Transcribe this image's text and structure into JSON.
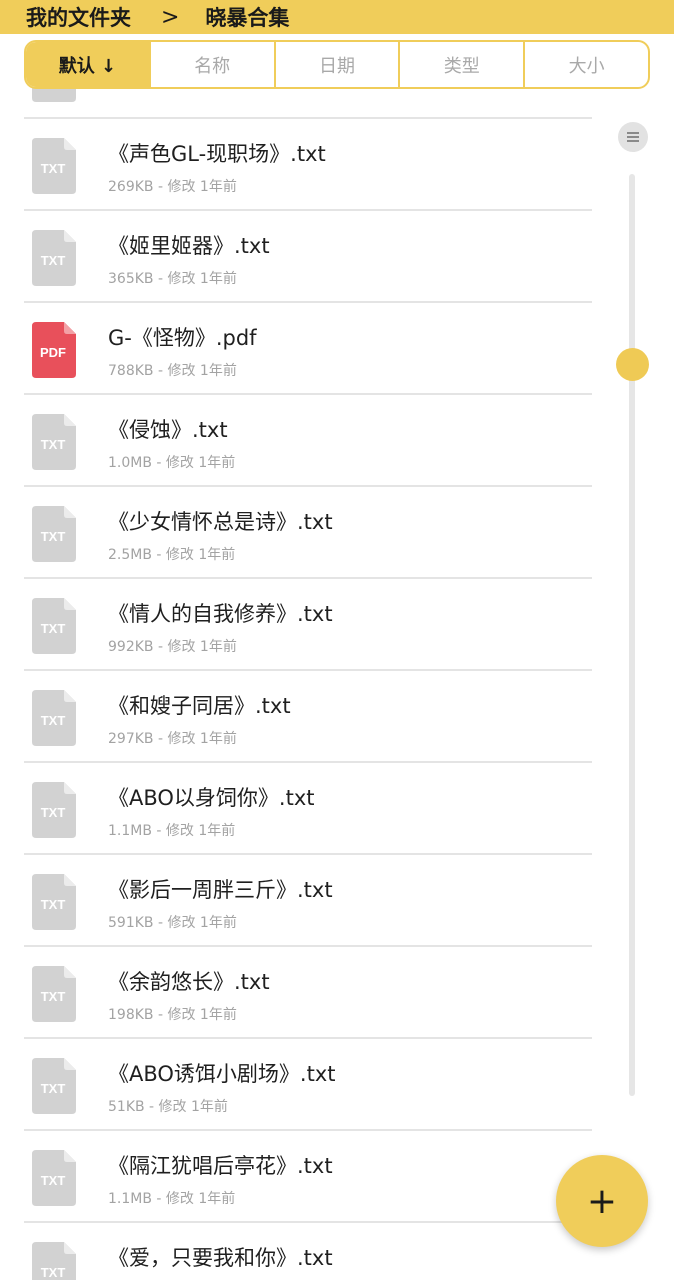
{
  "header": {
    "root": "我的文件夹",
    "separator": ">",
    "current": "晓暴合集"
  },
  "sort": {
    "active_label": "默认 ↓",
    "options": [
      "名称",
      "日期",
      "类型",
      "大小"
    ]
  },
  "files": [
    {
      "name": "",
      "meta": "",
      "type": "TXT"
    },
    {
      "name": "《声色GL-现职场》.txt",
      "meta": "269KB - 修改 1年前",
      "type": "TXT"
    },
    {
      "name": "《姬里姬器》.txt",
      "meta": "365KB - 修改 1年前",
      "type": "TXT"
    },
    {
      "name": "G-《怪物》.pdf",
      "meta": "788KB - 修改 1年前",
      "type": "PDF"
    },
    {
      "name": "《侵蚀》.txt",
      "meta": "1.0MB - 修改 1年前",
      "type": "TXT"
    },
    {
      "name": "《少女情怀总是诗》.txt",
      "meta": "2.5MB - 修改 1年前",
      "type": "TXT"
    },
    {
      "name": "《情人的自我修养》.txt",
      "meta": "992KB - 修改 1年前",
      "type": "TXT"
    },
    {
      "name": "《和嫂子同居》.txt",
      "meta": "297KB - 修改 1年前",
      "type": "TXT"
    },
    {
      "name": "《ABO以身饲你》.txt",
      "meta": "1.1MB - 修改 1年前",
      "type": "TXT"
    },
    {
      "name": "《影后一周胖三斤》.txt",
      "meta": "591KB - 修改 1年前",
      "type": "TXT"
    },
    {
      "name": "《余韵悠长》.txt",
      "meta": "198KB - 修改 1年前",
      "type": "TXT"
    },
    {
      "name": "《ABO诱饵小剧场》.txt",
      "meta": "51KB - 修改 1年前",
      "type": "TXT"
    },
    {
      "name": "《隔江犹唱后亭花》.txt",
      "meta": "1.1MB - 修改 1年前",
      "type": "TXT"
    },
    {
      "name": "《爱，只要我和你》.txt",
      "meta": "",
      "type": "TXT"
    }
  ],
  "fab": {
    "label": "+"
  },
  "colors": {
    "accent": "#f0cd5a",
    "pdf": "#e8505b",
    "txt_icon": "#d2d2d2"
  },
  "icons": {
    "menu": "menu-lines-icon",
    "add": "plus-icon",
    "file_txt": "txt-file-icon",
    "file_pdf": "pdf-file-icon"
  }
}
